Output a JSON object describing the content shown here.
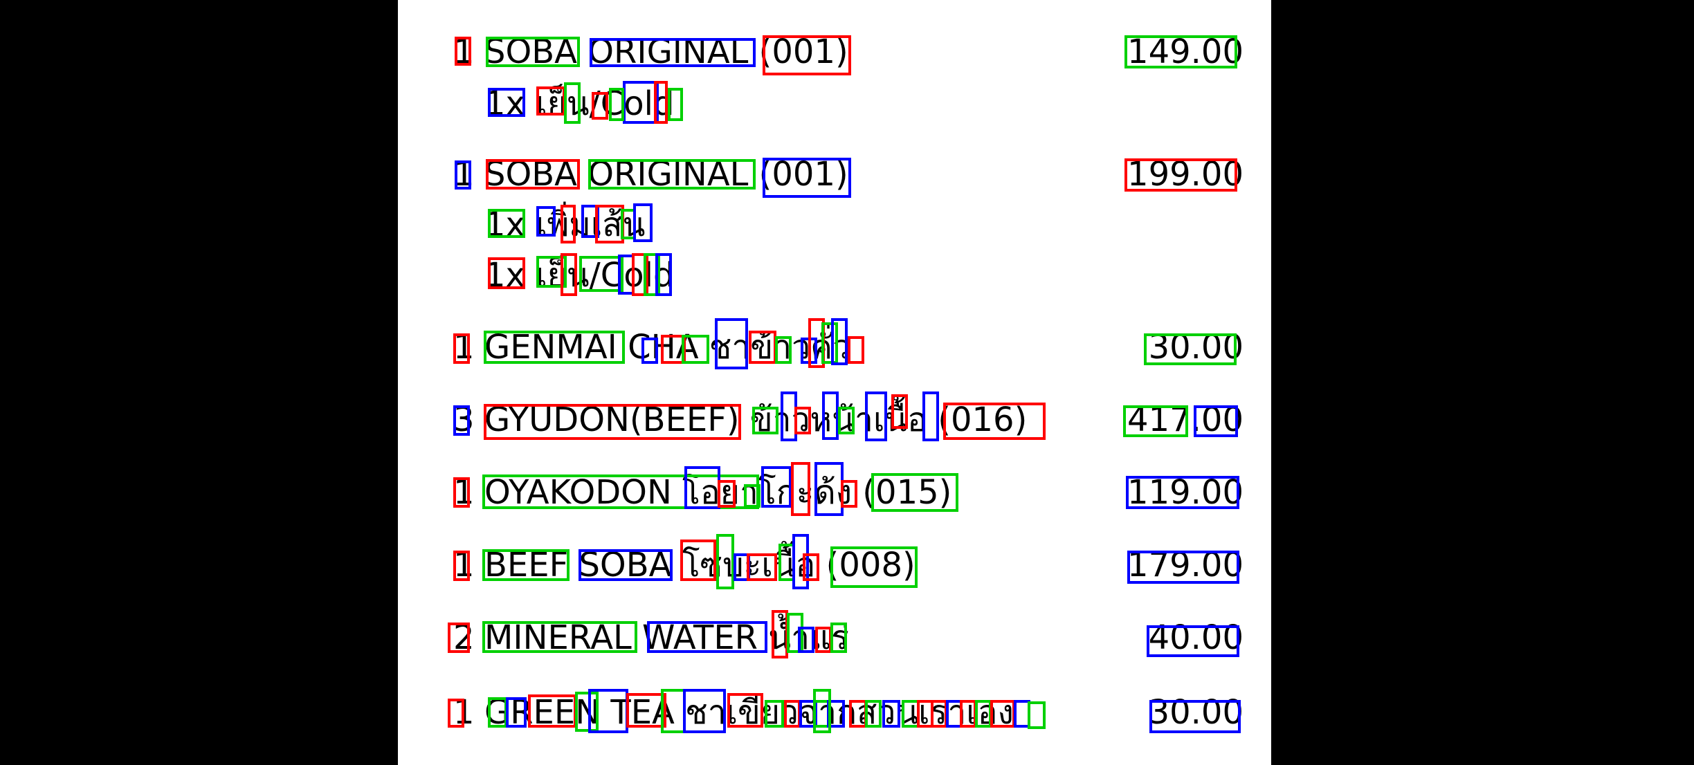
{
  "receipt": {
    "items": [
      {
        "qty": "1",
        "name": "SOBA ORIGINAL (001)",
        "price": "149.00",
        "subs": [
          "1x เย็น/Cold"
        ]
      },
      {
        "qty": "1",
        "name": "SOBA ORIGINAL (001)",
        "price": "199.00",
        "subs": [
          "1x เพิ่มเส้น",
          "1x เย็น/Cold"
        ]
      },
      {
        "qty": "1",
        "name": "GENMAI CHA ชาข้าวคั่ว",
        "price": "30.00",
        "subs": []
      },
      {
        "qty": "3",
        "name": "GYUDON(BEEF) ข้าวหน้าเนื้อ (016)",
        "price": "417.00",
        "subs": []
      },
      {
        "qty": "1",
        "name": "OYAKODON โอยาโกะด้ง (015)",
        "price": "119.00",
        "subs": []
      },
      {
        "qty": "1",
        "name": "BEEF SOBA โซบะเนื้อ (008)",
        "price": "179.00",
        "subs": []
      },
      {
        "qty": "2",
        "name": "MINERAL WATER น้ำแร่",
        "price": "40.00",
        "subs": []
      },
      {
        "qty": "1",
        "name": "GREEN TEA ชาเขียวจากสวนเราเอง",
        "price": "30.00",
        "subs": []
      }
    ]
  },
  "colors": {
    "box_red": "#ff0000",
    "box_green": "#00d000",
    "box_blue": "#0000ff"
  }
}
